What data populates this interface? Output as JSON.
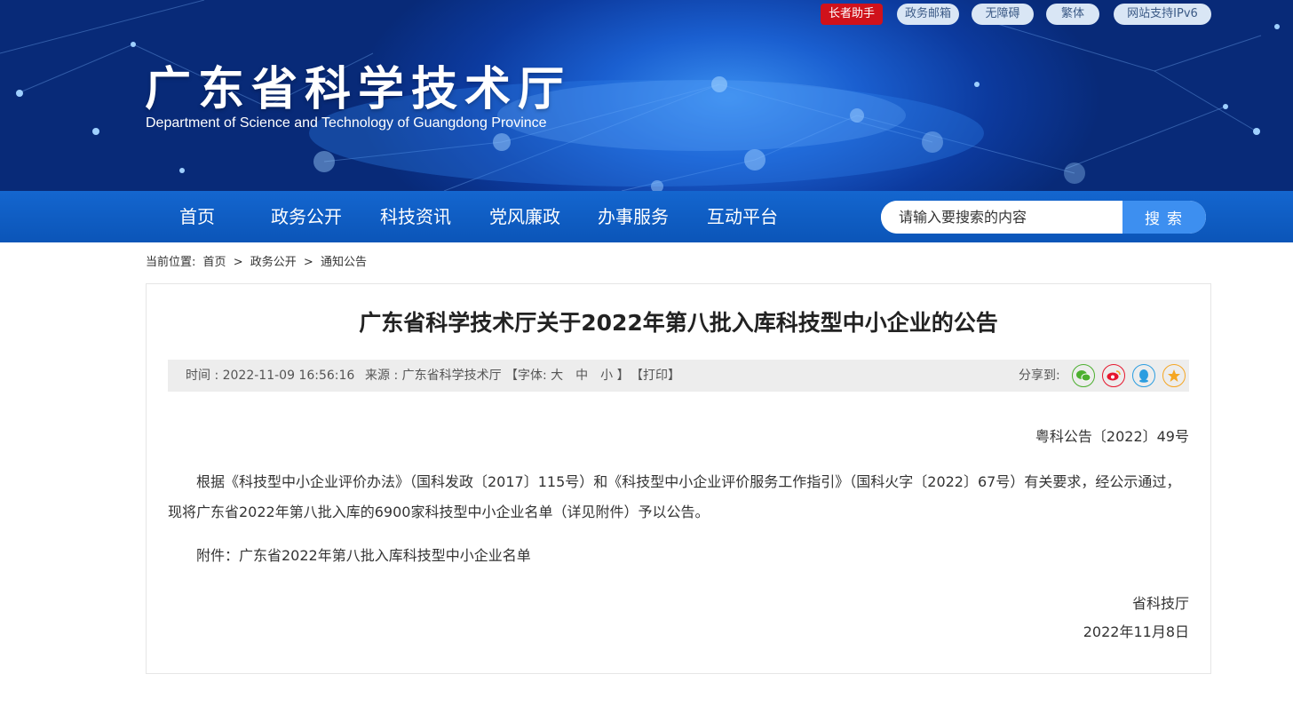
{
  "header": {
    "top_links": [
      {
        "label": "长者助手"
      },
      {
        "label": "政务邮箱"
      },
      {
        "label": "无障碍"
      },
      {
        "label": "繁体"
      },
      {
        "label": "网站支持IPv6"
      }
    ],
    "title": "广东省科学技术厅",
    "subtitle": "Department of Science and Technology of Guangdong Province"
  },
  "nav": {
    "items": [
      {
        "label": "首页"
      },
      {
        "label": "政务公开"
      },
      {
        "label": "科技资讯"
      },
      {
        "label": "党风廉政"
      },
      {
        "label": "办事服务"
      },
      {
        "label": "互动平台"
      }
    ],
    "search": {
      "placeholder": "请输入要搜索的内容",
      "button_label": "搜索"
    }
  },
  "breadcrumb": {
    "prefix": "当前位置:",
    "items": [
      "首页",
      ">",
      "政务公开",
      ">",
      "通知公告"
    ]
  },
  "article": {
    "title": "广东省科学技术厅关于2022年第八批入库科技型中小企业的公告",
    "meta": {
      "time": "时间 : 2022-11-09 16:56:16",
      "source": "来源 : 广东省科学技术厅",
      "font_size": "【字体: 大　中　小 】",
      "print": "【打印】",
      "share_label": "分享到:"
    },
    "share_icons": [
      {
        "name": "wechat-icon",
        "color": "#4caf2f"
      },
      {
        "name": "weibo-icon",
        "color": "#e6162d"
      },
      {
        "name": "qq-icon",
        "color": "#2b9de0"
      },
      {
        "name": "favorite-icon",
        "color": "#f5a623"
      }
    ],
    "doc_number": "粤科公告〔2022〕49号",
    "body": "根据《科技型中小企业评价办法》（国科发政〔2017〕115号）和《科技型中小企业评价服务工作指引》（国科火字〔2022〕67号）有关要求，经公示通过，现将广东省2022年第八批入库的6900家科技型中小企业名单（详见附件）予以公告。",
    "attachment": "附件：广东省2022年第八批入库科技型中小企业名单",
    "signer": "省科技厅",
    "date": "2022年11月8日"
  }
}
